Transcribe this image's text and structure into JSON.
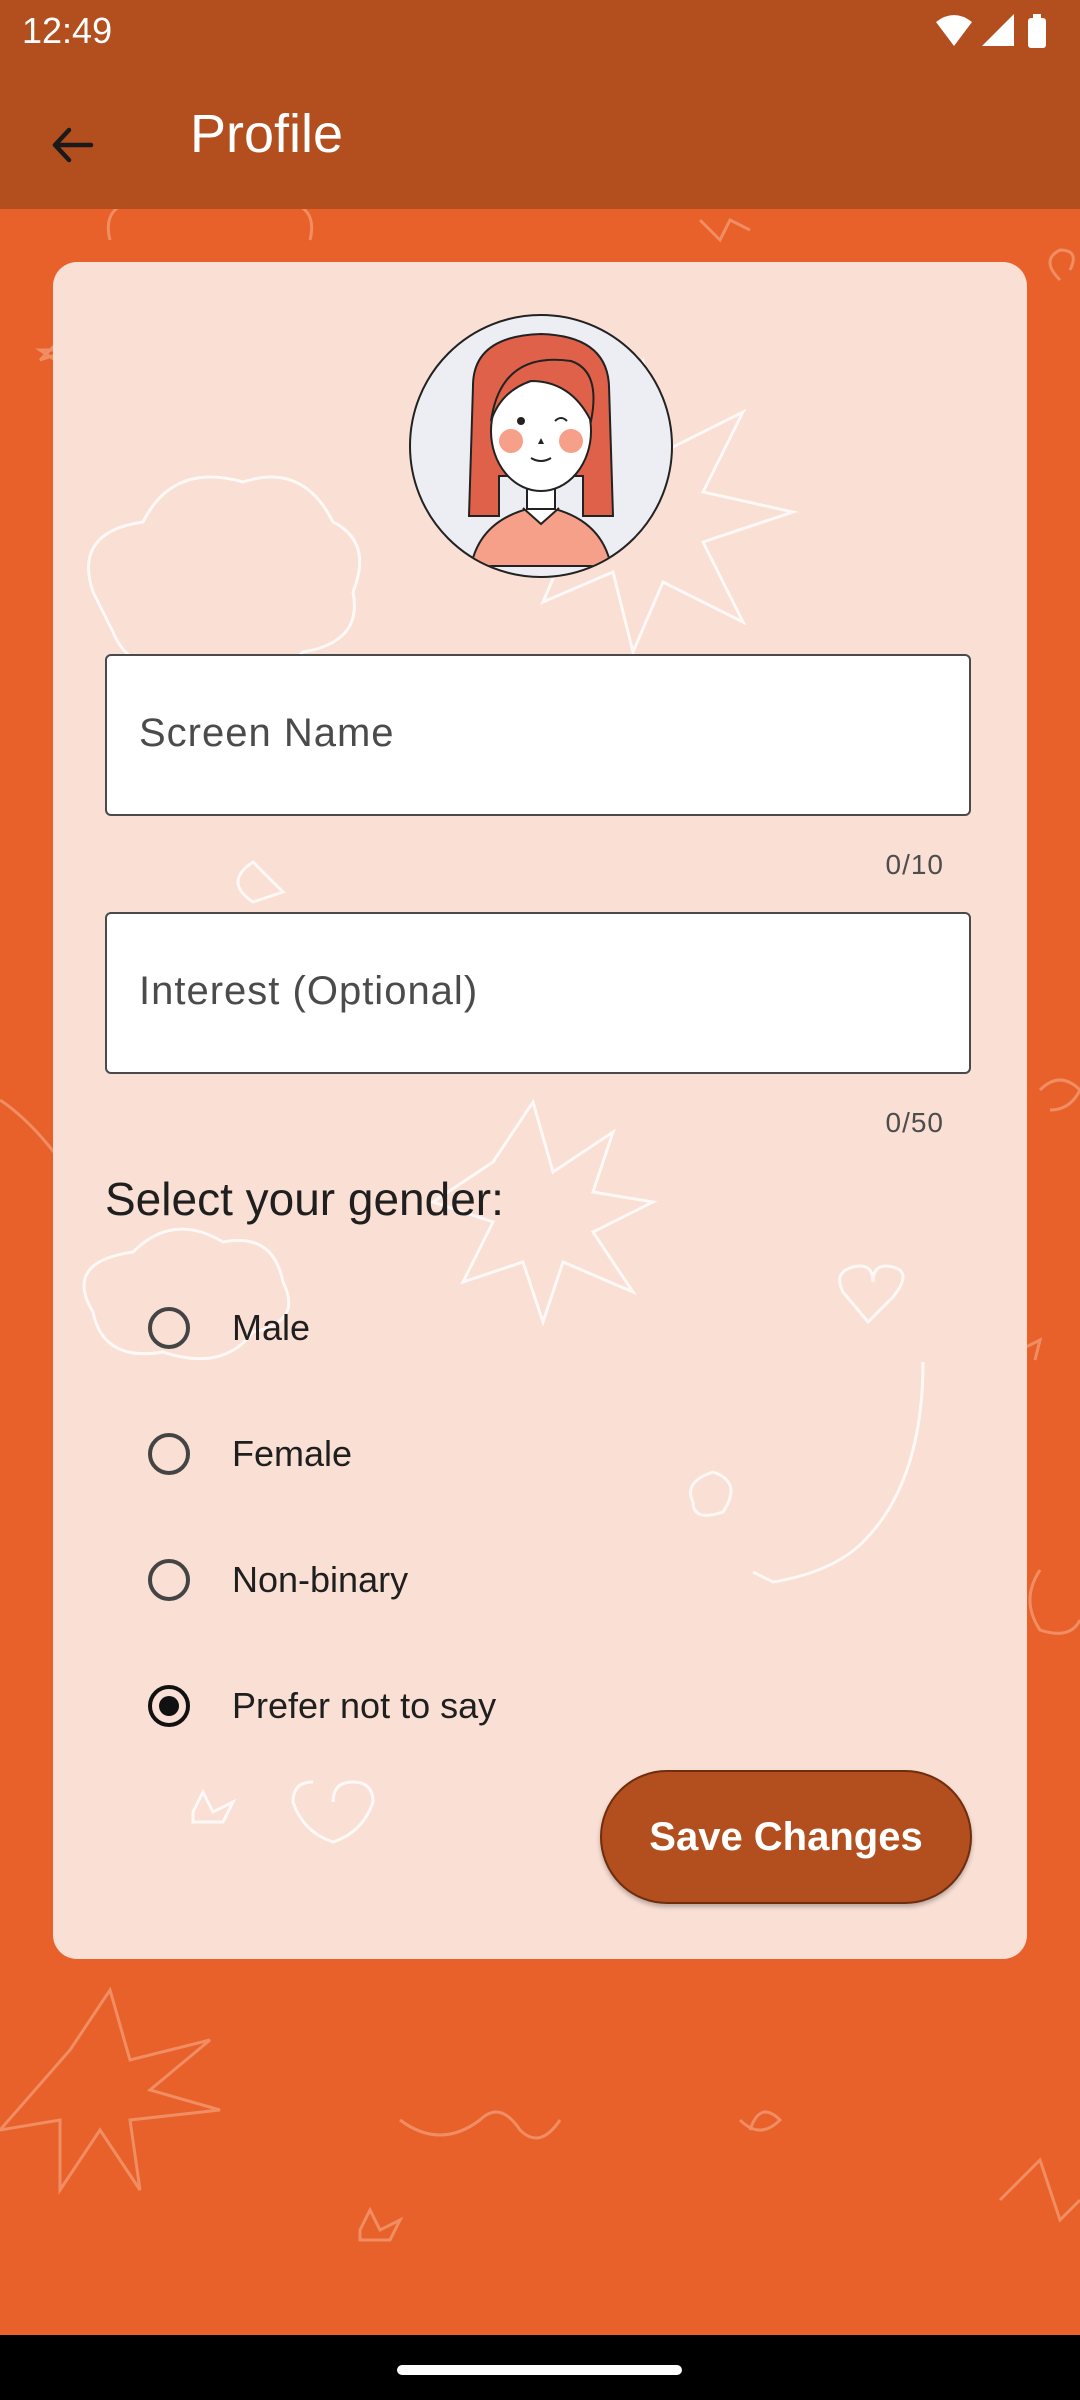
{
  "status_bar": {
    "time": "12:49",
    "icons": [
      "wifi-icon",
      "cellular-signal-icon",
      "battery-icon"
    ]
  },
  "app_bar": {
    "back_icon": "arrow-left-icon",
    "title": "Profile"
  },
  "form": {
    "screen_name": {
      "placeholder": "Screen Name",
      "value": "",
      "counter": "0/10"
    },
    "interest": {
      "placeholder": "Interest (Optional)",
      "value": "",
      "counter": "0/50"
    },
    "gender_heading": "Select your gender:",
    "gender_options": [
      {
        "label": "Male",
        "selected": false
      },
      {
        "label": "Female",
        "selected": false
      },
      {
        "label": "Non-binary",
        "selected": false
      },
      {
        "label": "Prefer not to say",
        "selected": true
      }
    ],
    "save_label": "Save Changes"
  },
  "colors": {
    "background": "#e8612a",
    "app_bar": "#b34e1e",
    "card": "#f9dfd4",
    "button": "#b34e1e"
  }
}
